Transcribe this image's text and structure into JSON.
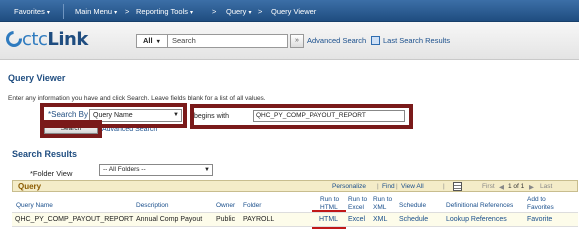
{
  "nav": {
    "items": [
      {
        "label": "Favorites",
        "caret": "▾"
      },
      {
        "label": "Main Menu",
        "caret": "▾"
      },
      {
        "label": "Reporting Tools",
        "caret": "▾"
      },
      {
        "label": "Query",
        "caret": "▾"
      },
      {
        "label": "Query Viewer",
        "caret": ""
      }
    ],
    "separators": [
      ">",
      ">",
      ">"
    ]
  },
  "header": {
    "logo_prefix": "ctc",
    "logo_suffix": "Link",
    "search_scope": "All",
    "search_scope_caret": "▾",
    "search_placeholder": "Search",
    "search_go": "»",
    "advanced_search": "Advanced Search",
    "last_search_results": "Last Search Results"
  },
  "page": {
    "title": "Query Viewer",
    "instructions": "Enter any information you have and click Search. Leave fields blank for a list of all values."
  },
  "search_form": {
    "search_by_label": "*Search By",
    "search_by_value": "Query Name",
    "begins_with": "begins with",
    "criteria_value": "QHC_PY_COMP_PAYOUT_REPORT",
    "search_button": "Search",
    "advanced_search": "Advanced Search"
  },
  "results": {
    "title": "Search Results",
    "folder_label": "*Folder View",
    "folder_value": "-- All Folders --",
    "grid_tab": "Query",
    "personalize": "Personalize",
    "find": "Find",
    "view_all": "View All",
    "pipe": "|",
    "first": "First",
    "paging": "1 of 1",
    "last": "Last",
    "columns": {
      "query_name": "Query Name",
      "description": "Description",
      "owner": "Owner",
      "folder": "Folder",
      "run_html_1": "Run to",
      "run_html_2": "HTML",
      "run_excel_1": "Run to",
      "run_excel_2": "Excel",
      "run_xml_1": "Run to",
      "run_xml_2": "XML",
      "schedule": "Schedule",
      "definitional_references": "Definitional References",
      "favorites_1": "Add to",
      "favorites_2": "Favorites"
    },
    "rows": [
      {
        "query_name": "QHC_PY_COMP_PAYOUT_REPORT",
        "description": "Annual Comp Payout",
        "owner": "Public",
        "folder": "PAYROLL",
        "run_html": "HTML",
        "run_excel": "Excel",
        "run_xml": "XML",
        "schedule": "Schedule",
        "definitional_references": "Lookup References",
        "favorites": "Favorite"
      }
    ]
  },
  "colors": {
    "accent": "#1f4d80",
    "highlight": "#7a1a1a",
    "grid_header": "#f4ecc8"
  }
}
